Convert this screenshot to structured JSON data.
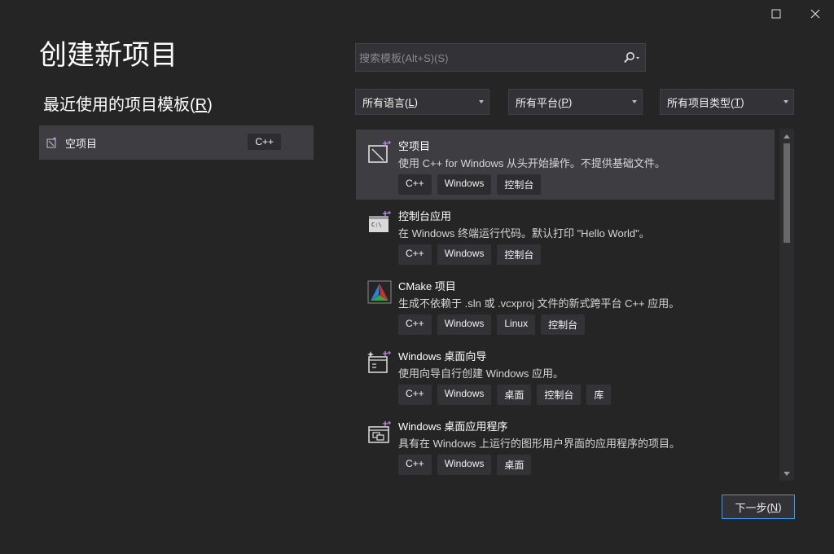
{
  "window": {
    "maximize_icon": "maximize-icon",
    "close_icon": "close-icon"
  },
  "page_title": "创建新项目",
  "recent": {
    "title_prefix": "最近使用的项目模板(",
    "title_key": "R",
    "title_suffix": ")",
    "items": [
      {
        "label": "空项目",
        "tag": "C++",
        "icon": "empty-project-icon"
      }
    ]
  },
  "search": {
    "placeholder": "搜索模板(Alt+S)(S)",
    "value": ""
  },
  "filters": {
    "language": {
      "prefix": "所有语言(",
      "key": "L",
      "suffix": ")"
    },
    "platform": {
      "prefix": "所有平台(",
      "key": "P",
      "suffix": ")"
    },
    "project_type": {
      "prefix": "所有项目类型(",
      "key": "T",
      "suffix": ")"
    }
  },
  "templates": [
    {
      "name": "空项目",
      "description": "使用 C++ for Windows 从头开始操作。不提供基础文件。",
      "tags": [
        "C++",
        "Windows",
        "控制台"
      ],
      "icon": "empty-project-icon",
      "selected": true
    },
    {
      "name": "控制台应用",
      "description": "在 Windows 终端运行代码。默认打印 \"Hello World\"。",
      "tags": [
        "C++",
        "Windows",
        "控制台"
      ],
      "icon": "console-app-icon",
      "selected": false
    },
    {
      "name": "CMake 项目",
      "description": "生成不依赖于 .sln 或 .vcxproj 文件的新式跨平台 C++ 应用。",
      "tags": [
        "C++",
        "Windows",
        "Linux",
        "控制台"
      ],
      "icon": "cmake-icon",
      "selected": false
    },
    {
      "name": "Windows 桌面向导",
      "description": "使用向导自行创建 Windows 应用。",
      "tags": [
        "C++",
        "Windows",
        "桌面",
        "控制台",
        "库"
      ],
      "icon": "desktop-wizard-icon",
      "selected": false
    },
    {
      "name": "Windows 桌面应用程序",
      "description": "具有在 Windows 上运行的图形用户界面的应用程序的项目。",
      "tags": [
        "C++",
        "Windows",
        "桌面"
      ],
      "icon": "desktop-app-icon",
      "selected": false
    }
  ],
  "next_button": {
    "prefix": "下一步(",
    "key": "N",
    "suffix": ")"
  },
  "colors": {
    "background": "#252526",
    "selected": "#3e3e42",
    "accent": "#3399ff",
    "cmake_red": "#d32f2f",
    "cmake_green": "#43a047",
    "cmake_blue": "#1e88e5"
  }
}
